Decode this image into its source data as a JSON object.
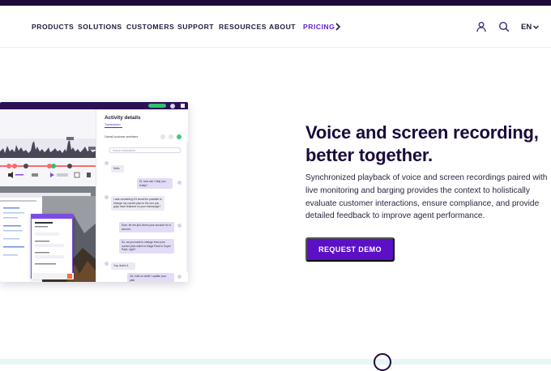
{
  "nav": {
    "items": [
      "PRODUCTS",
      "SOLUTIONS",
      "CUSTOMERS",
      "SUPPORT",
      "RESOURCES",
      "ABOUT",
      "PRICING"
    ],
    "language": "EN"
  },
  "hero": {
    "headline": "Voice and screen recording, better together.",
    "description": "Synchronized playback of voice and screen recordings paired with live monitoring and barging provides the context to holistically evaluate customer interactions, ensure compliance, and provide detailed feedback to improve agent performance.",
    "cta_label": "REQUEST DEMO"
  },
  "screenshot": {
    "panel_title": "Activity details",
    "tab_label": "Transcription",
    "sentiment_label": "Overall customer sentiment",
    "search_placeholder": "Search transcription",
    "messages": [
      {
        "side": "in",
        "text": "Hello"
      },
      {
        "side": "out",
        "text": "Hi, how can I help you today?"
      },
      {
        "side": "in",
        "text": "I was wondering if it would be possible to change my current plan to the one you guys have featured on your homepage?"
      },
      {
        "side": "out",
        "text": "Sure, let me just check your account for a second."
      },
      {
        "side": "out",
        "text": "So, as you want to change from your current plan which is Mega Pack to Super Pack, right?"
      },
      {
        "side": "in",
        "text": "Yup, that's it."
      },
      {
        "side": "out",
        "text": "Ok, hold on while I update your plan"
      }
    ]
  },
  "colors": {
    "brand_dark": "#190a3b",
    "accent": "#5b10c6",
    "nav_active": "#5b1fd0"
  }
}
